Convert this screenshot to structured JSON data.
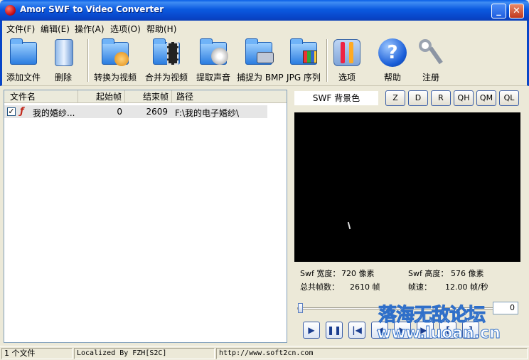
{
  "window": {
    "title": "Amor SWF to Video Converter",
    "minimize": "_",
    "close": "✕"
  },
  "menu": [
    "文件(F)",
    "编辑(E)",
    "操作(A)",
    "选项(O)",
    "帮助(H)"
  ],
  "toolbar": {
    "add_file": "添加文件",
    "delete": "删除",
    "convert_video": "转换为视频",
    "merge_video": "合并为视频",
    "extract_audio": "提取声音",
    "capture_bmp": "捕捉为 BMP",
    "jpg_sequence": "JPG 序列",
    "options": "选项",
    "help": "帮助",
    "register": "注册"
  },
  "file_list": {
    "columns": [
      "文件名",
      "起始帧",
      "结束帧",
      "路径"
    ],
    "rows": [
      {
        "checked": true,
        "name": "我的婚纱...",
        "start": "0",
        "end": "2609",
        "path": "F:\\我的电子婚纱\\"
      }
    ]
  },
  "preview": {
    "bg_label": "SWF 背景色",
    "quality_buttons": [
      "Z",
      "D",
      "R",
      "QH",
      "QM",
      "QL"
    ],
    "info": {
      "width_label": "Swf 宽度：",
      "width_value": "720 像素",
      "height_label": "Swf 高度：",
      "height_value": "576 像素",
      "frames_label": "总共帧数：",
      "frames_value": "2610 帧",
      "fps_label": "帧速：",
      "fps_value": "12.00 帧/秒"
    },
    "position": "0"
  },
  "controls": [
    "play",
    "pause",
    "first",
    "prev",
    "next",
    "last",
    "mark-in",
    "mark-out"
  ],
  "watermark": {
    "top": "落海无敌论坛",
    "bottom": "www.luoan.cn"
  },
  "status": {
    "count": "1 个文件",
    "localized": "Localized By FZH[S2C]",
    "url": "http://www.soft2cn.com"
  }
}
